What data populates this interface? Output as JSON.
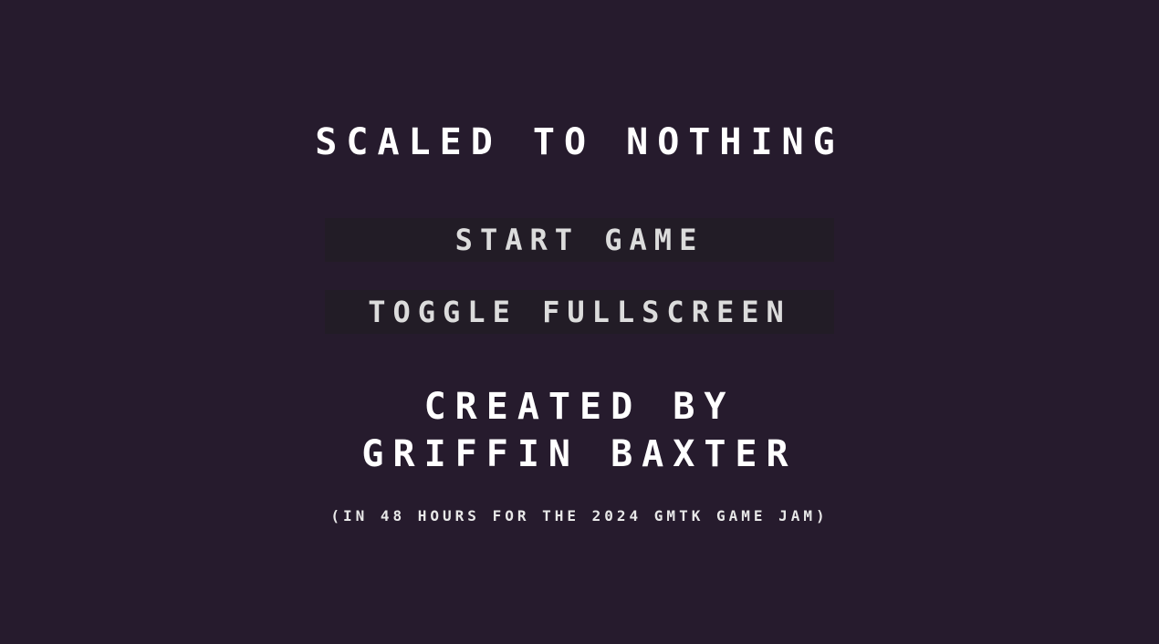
{
  "game": {
    "title": "SCALED TO NOTHING"
  },
  "menu": {
    "start_label": "START GAME",
    "fullscreen_label": "TOGGLE FULLSCREEN"
  },
  "credits": {
    "line1": "CREATED BY",
    "line2": "GRIFFIN BAXTER",
    "note": "(IN 48 HOURS FOR THE 2024 GMTK GAME JAM)"
  },
  "colors": {
    "background": "#261b2d",
    "button_bg": "#221c26",
    "text": "#ffffff"
  }
}
